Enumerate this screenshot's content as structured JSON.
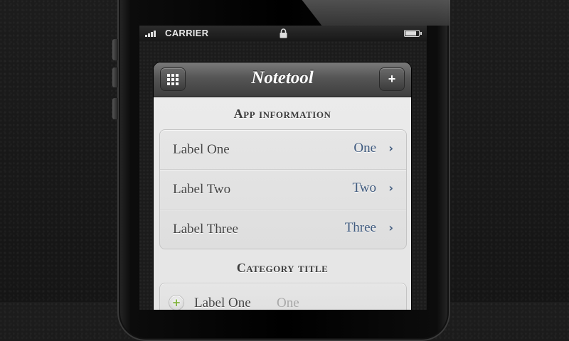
{
  "status_bar": {
    "carrier": "CARRIER",
    "signal_bars": 4,
    "battery_level": 0.85
  },
  "navbar": {
    "title": "Notetool",
    "add_label": "+"
  },
  "sections": [
    {
      "title": "App information",
      "rows": [
        {
          "label": "Label One",
          "value": "One"
        },
        {
          "label": "Label Two",
          "value": "Two"
        },
        {
          "label": "Label Three",
          "value": "Three"
        }
      ]
    },
    {
      "title": "Category title",
      "rows": [
        {
          "label": "Label One",
          "placeholder": "One"
        }
      ]
    }
  ],
  "colors": {
    "value_text": "#3f5a7e",
    "add_icon": "#7fb23a",
    "navbar": "#555555"
  },
  "chevron": "›"
}
